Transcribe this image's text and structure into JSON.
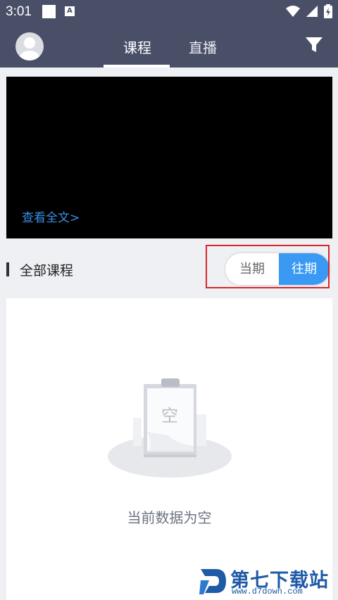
{
  "status_bar": {
    "time": "3:01",
    "a_badge": "A",
    "icons": [
      "square-icon",
      "a-notification-icon",
      "wifi-icon",
      "signal-icon",
      "battery-icon"
    ]
  },
  "header": {
    "tabs": [
      {
        "label": "课程",
        "active": true
      },
      {
        "label": "直播",
        "active": false
      }
    ],
    "icons": [
      "avatar-icon",
      "filter-icon"
    ]
  },
  "video": {
    "link_label": "查看全文>"
  },
  "section": {
    "title": "全部课程",
    "toggle": {
      "options": [
        "当期",
        "往期"
      ],
      "selected": "往期"
    }
  },
  "empty_state": {
    "illustration_text": "空",
    "message": "当前数据为空"
  },
  "watermark": {
    "name": "第七下载站",
    "url": "www.d7down.com"
  },
  "colors": {
    "header_bg": "#4a4f68",
    "accent": "#3a9af3",
    "link": "#3a8ee6",
    "highlight": "#d9262c",
    "watermark": "#1f5aa6"
  }
}
